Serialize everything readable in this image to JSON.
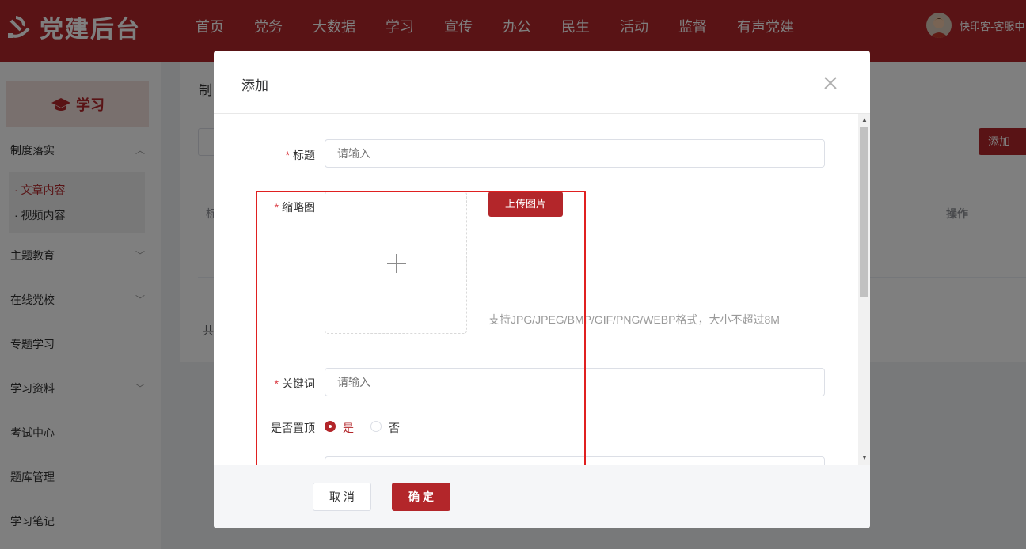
{
  "brand": {
    "title": "党建后台"
  },
  "nav": {
    "items": [
      "首页",
      "党务",
      "大数据",
      "学习",
      "宣传",
      "办公",
      "民生",
      "活动",
      "监督",
      "有声党建"
    ]
  },
  "user": {
    "name": "快印客-客服中"
  },
  "sidebar": {
    "banner_title": "学习",
    "items": [
      "制度落实",
      "主题教育",
      "在线党校",
      "专题学习",
      "学习资料",
      "考试中心",
      "题库管理",
      "学习笔记"
    ],
    "subitems": [
      "· 文章内容",
      "· 视频内容"
    ]
  },
  "main": {
    "title_partial": "制",
    "add_button": "添加",
    "column_title_partial": "标",
    "column_op": "操作",
    "total_partial": "共"
  },
  "modal": {
    "title": "添加",
    "form": {
      "title_label": "标题",
      "title_placeholder": "请输入",
      "thumb_label": "缩略图",
      "upload_button": "上传图片",
      "upload_tip": "支持JPG/JPEG/BMP/GIF/PNG/WEBP格式，大小不超过8M",
      "keyword_label": "关键词",
      "keyword_placeholder": "请输入",
      "top_label": "是否置顶",
      "top_options": [
        "是",
        "否"
      ],
      "top_selected": "是",
      "required_mark": "*"
    },
    "footer": {
      "cancel": "取 消",
      "ok": "确 定"
    }
  },
  "colors": {
    "brand_red": "#b3262a",
    "highlight_red": "#e02020"
  }
}
